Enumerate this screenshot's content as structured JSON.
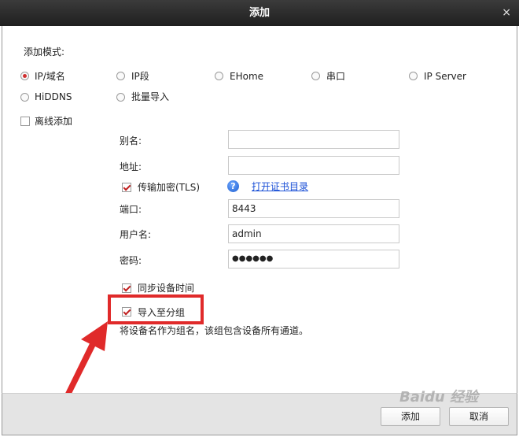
{
  "window": {
    "title": "添加",
    "close_glyph": "×"
  },
  "mode": {
    "label": "添加模式:",
    "options": [
      "IP/域名",
      "IP段",
      "EHome",
      "串口",
      "IP Server",
      "HiDDNS",
      "批量导入"
    ],
    "selected": "IP/域名"
  },
  "offline": {
    "label": "离线添加",
    "checked": false
  },
  "form": {
    "alias_label": "别名:",
    "alias_value": "",
    "address_label": "地址:",
    "address_value": "",
    "tls_label": "传输加密(TLS)",
    "tls_checked": true,
    "help_glyph": "?",
    "cert_link": "打开证书目录",
    "port_label": "端口:",
    "port_value": "8443",
    "user_label": "用户名:",
    "user_value": "admin",
    "password_label": "密码:",
    "password_value": "●●●●●●",
    "sync_time_label": "同步设备时间",
    "sync_time_checked": true,
    "import_group_label": "导入至分组",
    "import_group_checked": true,
    "import_group_note": "将设备名作为组名，该组包含设备所有通道。"
  },
  "footer": {
    "add_label": "添加",
    "cancel_label": "取消"
  },
  "watermark": {
    "text": "Baidu 经验"
  },
  "colors": {
    "accent": "#e02a2a",
    "link": "#1a4fd6",
    "titlebar": "#2a2a2a"
  }
}
